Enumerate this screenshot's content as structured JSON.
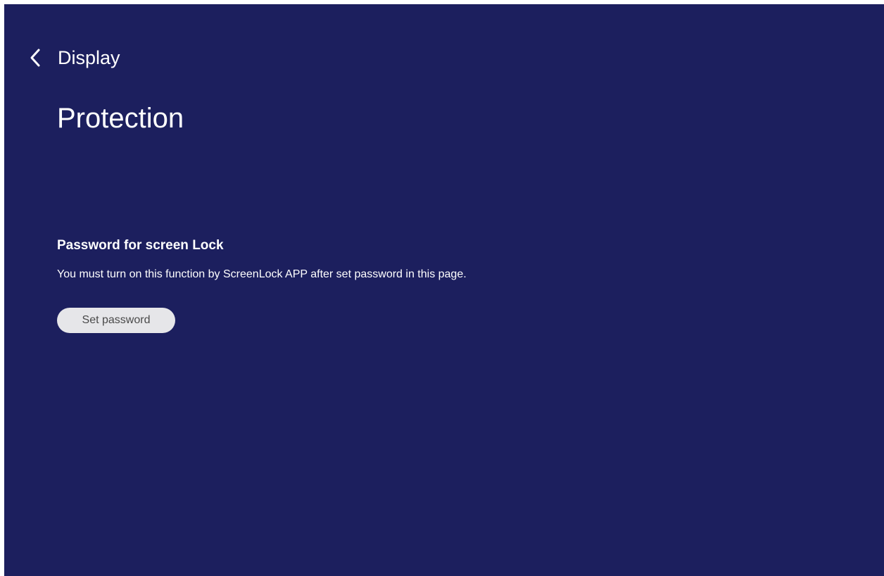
{
  "header": {
    "back_icon": "chevron-left-icon",
    "back_label": "Display"
  },
  "page": {
    "title": "Protection"
  },
  "password_section": {
    "title": "Password for screen Lock",
    "description": "You must turn on this function by ScreenLock APP after set password in this page.",
    "button_label": "Set password"
  },
  "colors": {
    "background": "#1c1f5e",
    "text": "#ffffff",
    "button_bg": "#e6e6e9",
    "button_text": "#4a4a4a"
  }
}
